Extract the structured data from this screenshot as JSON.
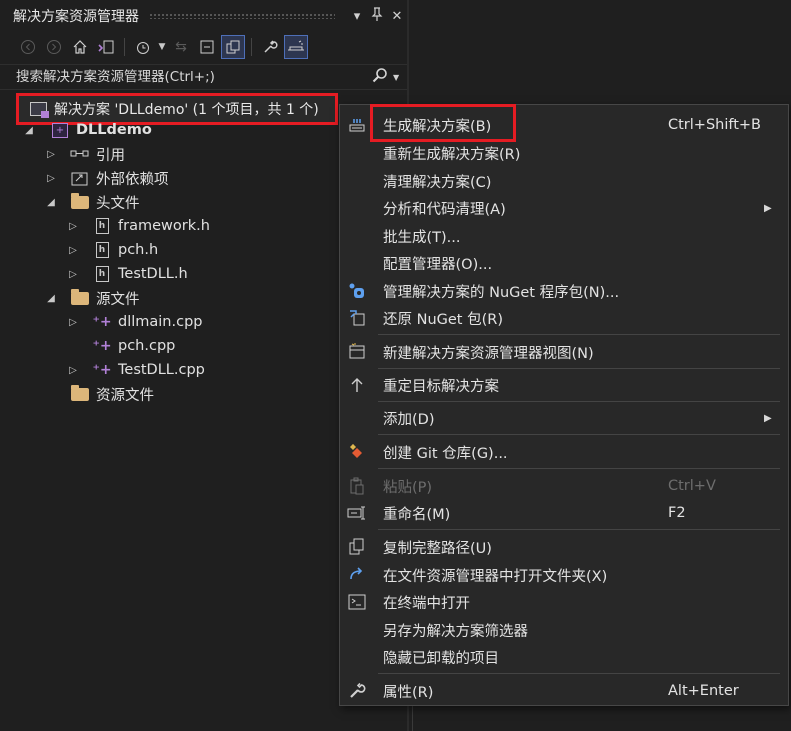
{
  "panel": {
    "title": "解决方案资源管理器",
    "title_icons": [
      "dropdown-icon",
      "pin-icon",
      "close-icon"
    ],
    "toolbar": [
      "back-icon",
      "forward-icon",
      "home-icon",
      "vs-switch-icon",
      "history-icon",
      "sync-icon",
      "collapse-all-icon",
      "show-all-files-icon",
      "properties-wrench-icon",
      "preview-icon"
    ],
    "search_placeholder": "搜索解决方案资源管理器(Ctrl+;)"
  },
  "tree": {
    "solution": "解决方案 'DLLdemo' (1 个项目，共 1 个)",
    "project": "DLLdemo",
    "items": [
      {
        "label": "引用",
        "icon": "references-icon"
      },
      {
        "label": "外部依赖项",
        "icon": "external-deps-icon"
      },
      {
        "label": "头文件",
        "icon": "folder-icon"
      },
      {
        "label": "framework.h",
        "icon": "header-file-icon"
      },
      {
        "label": "pch.h",
        "icon": "header-file-icon"
      },
      {
        "label": "TestDLL.h",
        "icon": "header-file-icon"
      },
      {
        "label": "源文件",
        "icon": "folder-icon"
      },
      {
        "label": "dllmain.cpp",
        "icon": "cpp-file-icon"
      },
      {
        "label": "pch.cpp",
        "icon": "cpp-file-icon"
      },
      {
        "label": "TestDLL.cpp",
        "icon": "cpp-file-icon"
      },
      {
        "label": "资源文件",
        "icon": "folder-icon"
      }
    ]
  },
  "menu": {
    "items": [
      {
        "label": "生成解决方案(B)",
        "shortcut": "Ctrl+Shift+B"
      },
      {
        "label": "重新生成解决方案(R)"
      },
      {
        "label": "清理解决方案(C)"
      },
      {
        "label": "分析和代码清理(A)"
      },
      {
        "label": "批生成(T)..."
      },
      {
        "label": "配置管理器(O)..."
      },
      {
        "label": "管理解决方案的 NuGet 程序包(N)..."
      },
      {
        "label": "还原 NuGet 包(R)"
      },
      {
        "label": "新建解决方案资源管理器视图(N)"
      },
      {
        "label": "重定目标解决方案"
      },
      {
        "label": "添加(D)"
      },
      {
        "label": "创建 Git 仓库(G)..."
      },
      {
        "label": "粘贴(P)",
        "shortcut": "Ctrl+V"
      },
      {
        "label": "重命名(M)",
        "shortcut": "F2"
      },
      {
        "label": "复制完整路径(U)"
      },
      {
        "label": "在文件资源管理器中打开文件夹(X)"
      },
      {
        "label": "在终端中打开"
      },
      {
        "label": "另存为解决方案筛选器"
      },
      {
        "label": "隐藏已卸载的项目"
      },
      {
        "label": "属性(R)",
        "shortcut": "Alt+Enter"
      }
    ]
  },
  "colors": {
    "highlight": "#e51c23",
    "background": "#1f1f1f",
    "menu_background": "#282828",
    "folder": "#dcb67a",
    "cpp_accent": "#b180d7"
  }
}
